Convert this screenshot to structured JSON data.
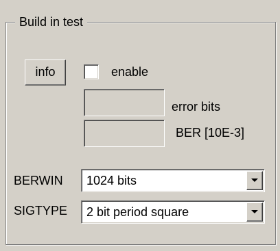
{
  "group_title": "Build in test",
  "controls": {
    "info_button_label": "info",
    "enable_label": "enable",
    "enable_checked": false,
    "error_bits_label": "error bits",
    "error_bits_value": "",
    "ber_label": "BER [10E-3]",
    "ber_value": ""
  },
  "berwin": {
    "label": "BERWIN",
    "value": "1024 bits"
  },
  "sigtype": {
    "label": "SIGTYPE",
    "value": "2 bit period square"
  },
  "icons": {
    "dropdown": "chevron-down-icon",
    "checkbox": "checkbox-icon"
  }
}
